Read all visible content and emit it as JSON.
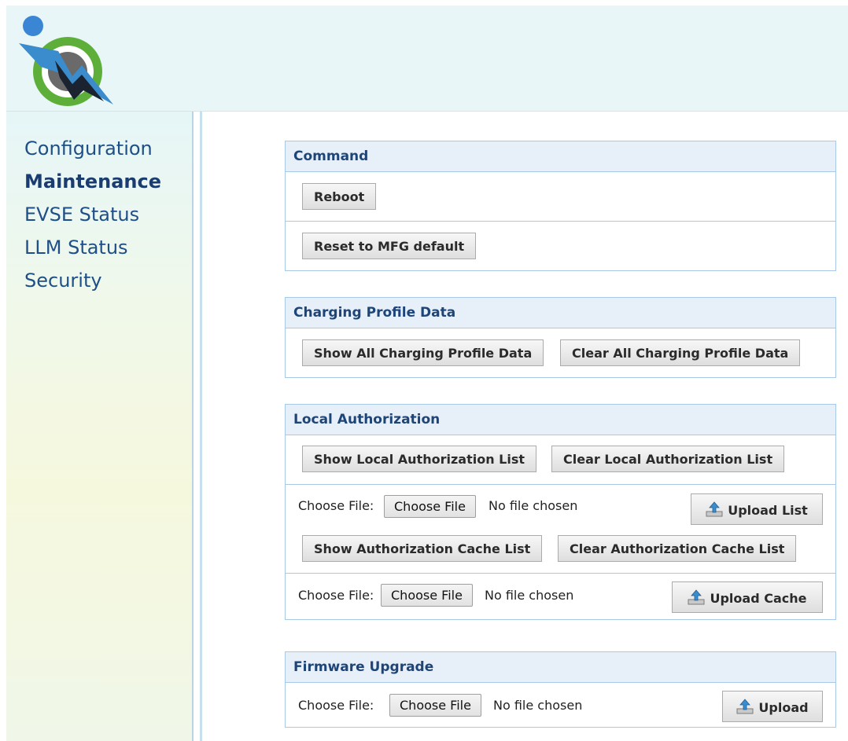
{
  "nav": {
    "items": [
      {
        "label": "Configuration",
        "active": false
      },
      {
        "label": "Maintenance",
        "active": true
      },
      {
        "label": "EVSE Status",
        "active": false
      },
      {
        "label": "LLM Status",
        "active": false
      },
      {
        "label": "Security",
        "active": false
      }
    ]
  },
  "command": {
    "title": "Command",
    "reboot_label": "Reboot",
    "reset_label": "Reset to MFG default"
  },
  "charging_profile": {
    "title": "Charging Profile Data",
    "show_label": "Show All Charging Profile Data",
    "clear_label": "Clear All Charging Profile Data"
  },
  "local_auth": {
    "title": "Local Authorization",
    "show_list_label": "Show Local Authorization List",
    "clear_list_label": "Clear Local Authorization List",
    "list_file_label": "Choose File:",
    "list_file_button": "Choose File",
    "list_file_status": "No file chosen",
    "upload_list_label": "Upload List",
    "show_cache_label": "Show Authorization Cache List",
    "clear_cache_label": "Clear Authorization Cache List",
    "cache_file_label": "Choose File:",
    "cache_file_button": "Choose File",
    "cache_file_status": "No file chosen",
    "upload_cache_label": "Upload Cache"
  },
  "firmware": {
    "title": "Firmware Upgrade",
    "file_label": "Choose File:",
    "file_button": "Choose File",
    "file_status": "No file chosen",
    "upload_label": "Upload"
  },
  "icons": {
    "logo": "lightning-plug-logo",
    "upload": "upload-icon"
  },
  "colors": {
    "header_bg": "#e8f6f8",
    "nav_text": "#1e4f86",
    "panel_border": "#a8c8e8",
    "panel_head_bg": "#e7eff9",
    "panel_title": "#1e4578"
  }
}
